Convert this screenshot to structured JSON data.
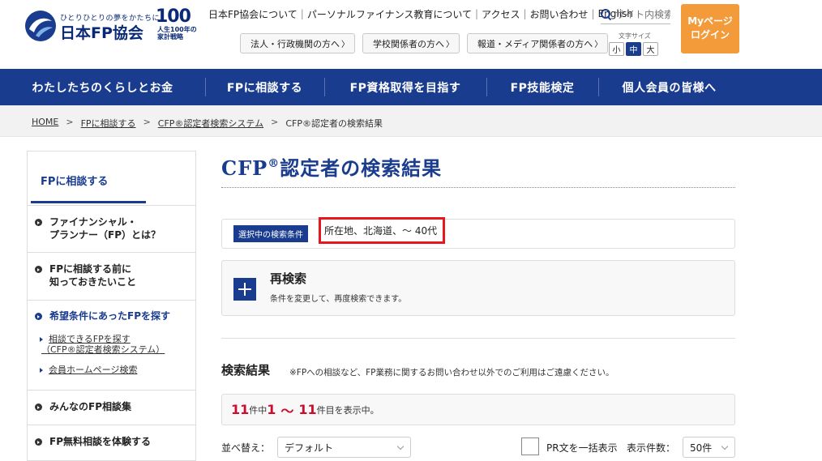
{
  "header": {
    "logo_tagline": "ひとりひとりの夢をかたちに",
    "logo_name": "日本FP協会",
    "badge_number": "100",
    "badge_line1": "人生100年の",
    "badge_line2": "家計戦略",
    "top_links": [
      "日本FP協会について",
      "パーソナルファイナンス教育について",
      "アクセス",
      "お問い合わせ",
      "English"
    ],
    "search_placeholder": "サイト内検索",
    "mypage_line1": "Myページ",
    "mypage_line2": "ログイン",
    "audience_buttons": [
      "法人・行政機関の方へ",
      "学校関係者の方へ",
      "報道・メディア関係者の方へ"
    ],
    "font_size_label": "文字サイズ",
    "font_sizes": [
      "小",
      "中",
      "大"
    ],
    "font_size_selected": "中"
  },
  "gnav": [
    "わたしたちのくらしとお金",
    "FPに相談する",
    "FP資格取得を目指す",
    "FP技能検定",
    "個人会員の皆様へ"
  ],
  "breadcrumb": [
    "HOME",
    "FPに相談する",
    "CFP®認定者検索システム",
    "CFP®認定者の検索結果"
  ],
  "sidebar": {
    "heading": "FPに相談する",
    "items": [
      {
        "line1": "ファイナンシャル・",
        "line2": "プランナー（FP）とは？"
      },
      {
        "line1": "FPに相談する前に",
        "line2": "知っておきたいこと"
      },
      {
        "line1": "希望条件にあったFPを探す"
      },
      {
        "line1": "みんなのFP相談集"
      },
      {
        "line1": "FP無料相談を体験する"
      }
    ],
    "sub_items": [
      {
        "line1": "相談できるFPを探す",
        "line2": "（CFP®認定者検索システム）"
      },
      {
        "line1": "会員ホームページ検索"
      }
    ]
  },
  "main": {
    "title_pre": "CFP",
    "title_sup": "®",
    "title_post": "認定者の検索結果",
    "condition_tag": "選択中の検索条件",
    "condition_value": "所在地、北海道、～ 40代",
    "research_title": "再検索",
    "research_desc": "条件を変更して、再度検索できます。",
    "results_title": "検索結果",
    "results_note": "※FPへの相談など、FP業務に関するお問い合わせ以外でのご利用はご遠慮ください。",
    "count_total": "11",
    "count_total_unit": "件中",
    "count_from": "1",
    "count_tilde": "～",
    "count_to": "11",
    "count_tail": "件目を表示中。",
    "sort_label": "並べ替え：",
    "sort_value": "デフォルト",
    "pr_label": "PR文を一括表示",
    "per_page_label": "表示件数：",
    "per_page_value": "50件"
  }
}
